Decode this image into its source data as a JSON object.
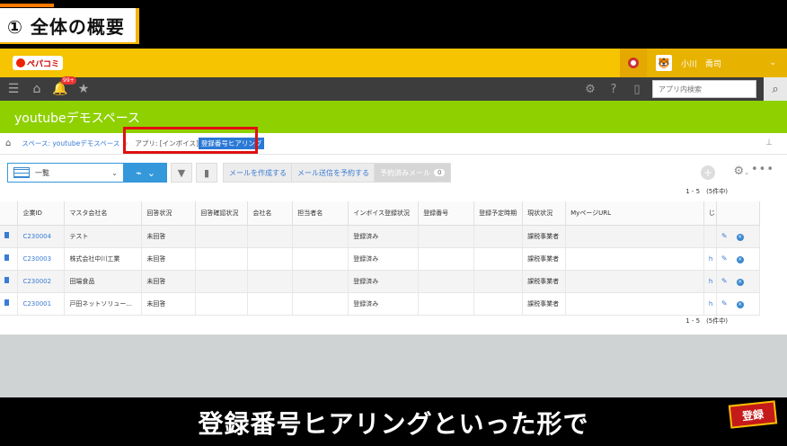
{
  "overlay": {
    "section_title": "① 全体の概要",
    "caption": "登録番号ヒアリングといった形で",
    "subscribe_badge": "登録"
  },
  "header": {
    "logo_text": "ぺパコミ",
    "user_name": "小川　喬司"
  },
  "nav": {
    "badge_count": "99+",
    "search_placeholder": "アプリ内検索"
  },
  "space": {
    "title": "youtubeデモスペース"
  },
  "breadcrumb": {
    "space_label": "スペース: youtubeデモスペース",
    "app_prefix": "アプリ: [インボイス]",
    "app_name": "登録番号ヒアリング"
  },
  "toolbar": {
    "view_name": "一覧",
    "create_mail": "メールを作成する",
    "schedule_mail": "メール送信を予約する",
    "scheduled_mail": "予約済みメール",
    "scheduled_count": "0"
  },
  "pager": {
    "range": "1 - 5　(5件中)"
  },
  "table": {
    "headers": [
      "企業ID",
      "マスタ会社名",
      "回答状況",
      "回答確認状況",
      "会社名",
      "担当者名",
      "インボイス登録状況",
      "登録番号",
      "登録予定時期",
      "現状状況",
      "MyページURL",
      "じ"
    ],
    "rows": [
      {
        "id": "C230004",
        "master": "テスト",
        "answer": "未回答",
        "invoice": "登録済み",
        "status": "課税事業者",
        "url": ""
      },
      {
        "id": "C230003",
        "master": "株式会社中川工業",
        "answer": "未回答",
        "invoice": "登録済み",
        "status": "課税事業者",
        "url": "h"
      },
      {
        "id": "C230002",
        "master": "田端食品",
        "answer": "未回答",
        "invoice": "登録済み",
        "status": "課税事業者",
        "url": "h"
      },
      {
        "id": "C230001",
        "master": "戸田ネットソリュー...",
        "answer": "未回答",
        "invoice": "登録済み",
        "status": "課税事業者",
        "url": "h"
      }
    ]
  },
  "colors": {
    "header_yellow": "#f6c400",
    "space_green": "#8fd000",
    "nav_dark": "#3d3d3d",
    "link_blue": "#3a7bd5",
    "highlight_red": "#e01010"
  }
}
